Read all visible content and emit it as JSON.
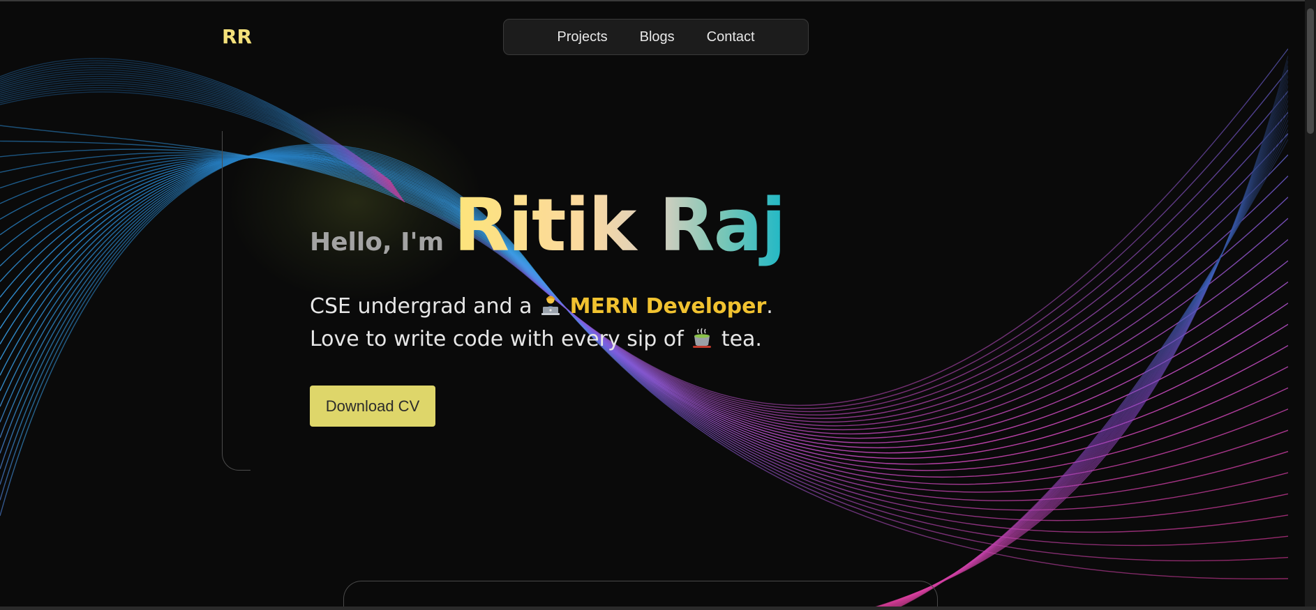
{
  "brand": {
    "logo": "RR"
  },
  "nav": {
    "items": [
      {
        "label": "Projects"
      },
      {
        "label": "Blogs"
      },
      {
        "label": "Contact"
      }
    ]
  },
  "hero": {
    "greeting": "Hello, I'm",
    "name": "Ritik Raj",
    "line1_prefix": "CSE undergrad and a",
    "line1_emoji": "technologist-icon",
    "line1_role": "MERN Developer",
    "line1_suffix": ".",
    "line2_prefix": "Love to write code with every sip of",
    "line2_emoji": "tea-cup-icon",
    "line2_suffix": "tea.",
    "cta_label": "Download CV"
  },
  "colors": {
    "background": "#0a0a0a",
    "logo": "#f3e07a",
    "role_highlight": "#f1c230",
    "cta_background": "#ded66a",
    "name_gradient": [
      "#fde47a",
      "#fbd9a0",
      "#d8cfc0",
      "#7fc7b6",
      "#1fb8c6"
    ],
    "wave_gradient": [
      "#2f9be0",
      "#7b5fe0",
      "#e23fa4"
    ]
  }
}
